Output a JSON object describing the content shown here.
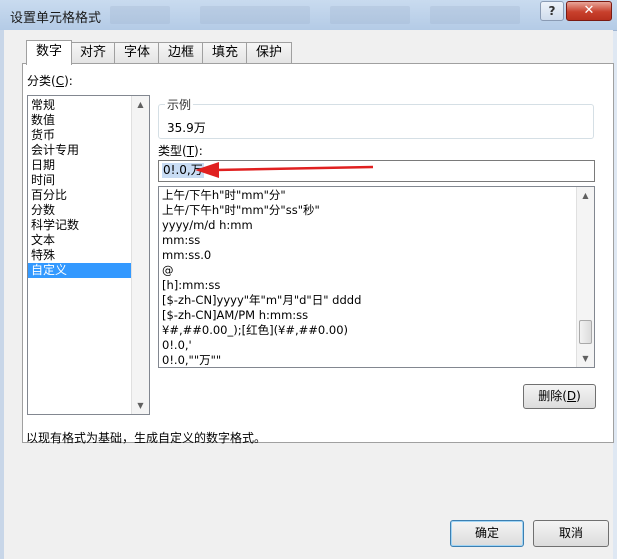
{
  "window": {
    "title": "设置单元格格式",
    "help_label": "?",
    "close_label": "✕"
  },
  "tabs": [
    {
      "label": "数字",
      "active": true
    },
    {
      "label": "对齐",
      "active": false
    },
    {
      "label": "字体",
      "active": false
    },
    {
      "label": "边框",
      "active": false
    },
    {
      "label": "填充",
      "active": false
    },
    {
      "label": "保护",
      "active": false
    }
  ],
  "category": {
    "label_prefix": "分类(",
    "label_key": "C",
    "label_suffix": "):",
    "items": [
      "常规",
      "数值",
      "货币",
      "会计专用",
      "日期",
      "时间",
      "百分比",
      "分数",
      "科学记数",
      "文本",
      "特殊",
      "自定义"
    ],
    "selected": "自定义"
  },
  "sample": {
    "legend": "示例",
    "value": "35.9万"
  },
  "type": {
    "label_prefix": "类型(",
    "label_key": "T",
    "label_suffix": "):",
    "value": "0!.0,万",
    "formats": [
      "上午/下午h\"时\"mm\"分\"",
      "上午/下午h\"时\"mm\"分\"ss\"秒\"",
      "yyyy/m/d h:mm",
      "mm:ss",
      "mm:ss.0",
      "@",
      "[h]:mm:ss",
      "[$-zh-CN]yyyy\"年\"m\"月\"d\"日\" dddd",
      "[$-zh-CN]AM/PM h:mm:ss",
      "¥#,##0.00_);[红色](¥#,##0.00)",
      "0!.0,'",
      "0!.0,\"\"万\"\""
    ]
  },
  "buttons": {
    "delete_prefix": "删除(",
    "delete_key": "D",
    "delete_suffix": ")",
    "ok": "确定",
    "cancel": "取消"
  },
  "description": "以现有格式为基础，生成自定义的数字格式。",
  "colors": {
    "selection": "#3399ff",
    "arrow": "#e02020"
  },
  "icons": {
    "scroll_up": "▲",
    "scroll_down": "▼"
  }
}
